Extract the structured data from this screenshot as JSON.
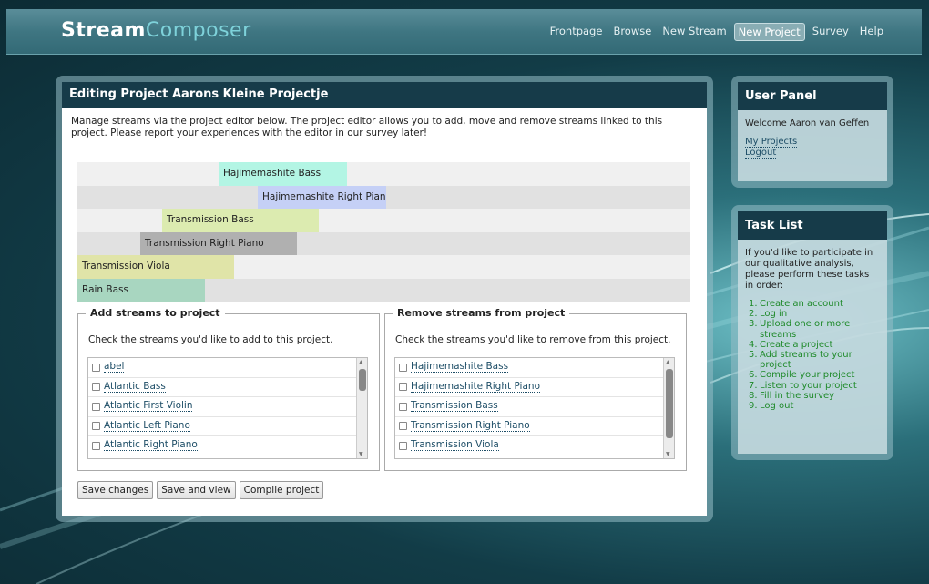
{
  "app": {
    "brand_bold": "Stream",
    "brand_light": "Composer"
  },
  "nav": {
    "items": [
      {
        "label": "Frontpage",
        "active": false
      },
      {
        "label": "Browse",
        "active": false
      },
      {
        "label": "New Stream",
        "active": false
      },
      {
        "label": "New Project",
        "active": true
      },
      {
        "label": "Survey",
        "active": false
      },
      {
        "label": "Help",
        "active": false
      }
    ]
  },
  "editor": {
    "title": "Editing Project Aarons Kleine Projectje",
    "intro": "Manage streams via the project editor below. The project editor allows you to add, move and remove streams linked to this project. Please report your experiences with the editor in our survey later!",
    "streams": [
      {
        "label": "Hajimemashite Bass",
        "color": "#b3f5e4"
      },
      {
        "label": "Hajimemashite Right Piano",
        "color": "#c5d0f6"
      },
      {
        "label": "Transmission Bass",
        "color": "#dcebb0"
      },
      {
        "label": "Transmission Right Piano",
        "color": "#b0b0b0"
      },
      {
        "label": "Transmission Viola",
        "color": "#e0e4a8"
      },
      {
        "label": "Rain Bass",
        "color": "#a8d6c0"
      }
    ]
  },
  "add_panel": {
    "legend": "Add streams to project",
    "description": "Check the streams you'd like to add to this project.",
    "items": [
      "abel",
      "Atlantic Bass",
      "Atlantic First Violin",
      "Atlantic Left Piano",
      "Atlantic Right Piano"
    ]
  },
  "remove_panel": {
    "legend": "Remove streams from project",
    "description": "Check the streams you'd like to remove from this project.",
    "items": [
      "Hajimemashite Bass",
      "Hajimemashite Right Piano",
      "Transmission Bass",
      "Transmission Right Piano",
      "Transmission Viola"
    ]
  },
  "buttons": {
    "save": "Save changes",
    "save_view": "Save and view",
    "compile": "Compile project"
  },
  "user_panel": {
    "title": "User Panel",
    "welcome": "Welcome Aaron van Geffen",
    "my_projects": "My Projects",
    "logout": "Logout"
  },
  "task_list": {
    "title": "Task List",
    "intro": "If you'd like to participate in our qualitative analysis, please perform these tasks in order:",
    "tasks": [
      {
        "n": "1.",
        "text": "Create an account"
      },
      {
        "n": "2.",
        "text": "Log in"
      },
      {
        "n": "3.",
        "text": "Upload one or more streams"
      },
      {
        "n": "4.",
        "text": "Create a project"
      },
      {
        "n": "5.",
        "text": "Add streams to your project"
      },
      {
        "n": "6.",
        "text": "Compile your project"
      },
      {
        "n": "7.",
        "text": "Listen to your project"
      },
      {
        "n": "8.",
        "text": "Fill in the survey"
      },
      {
        "n": "9.",
        "text": "Log out"
      }
    ]
  }
}
